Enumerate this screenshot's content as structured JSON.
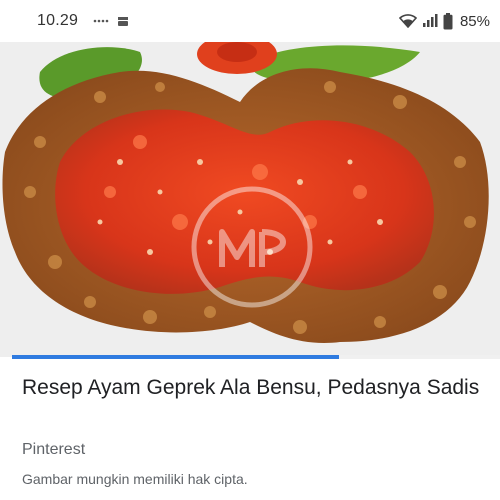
{
  "status_bar": {
    "time": "10.29",
    "battery_percent": "85%",
    "icons": [
      "notification-dots-icon",
      "app-notification-icon",
      "wifi-icon",
      "signal-icon",
      "battery-icon"
    ]
  },
  "image": {
    "subject": "fried chicken with red chili sambal",
    "watermark_icon": "watermark-logo-icon"
  },
  "progress": {
    "fraction": 0.67,
    "color": "#2f7be0"
  },
  "result": {
    "title": "Resep Ayam Geprek Ala Bensu, Pedasnya Sadis",
    "source": "Pinterest",
    "note": "Gambar mungkin memiliki hak cipta."
  }
}
